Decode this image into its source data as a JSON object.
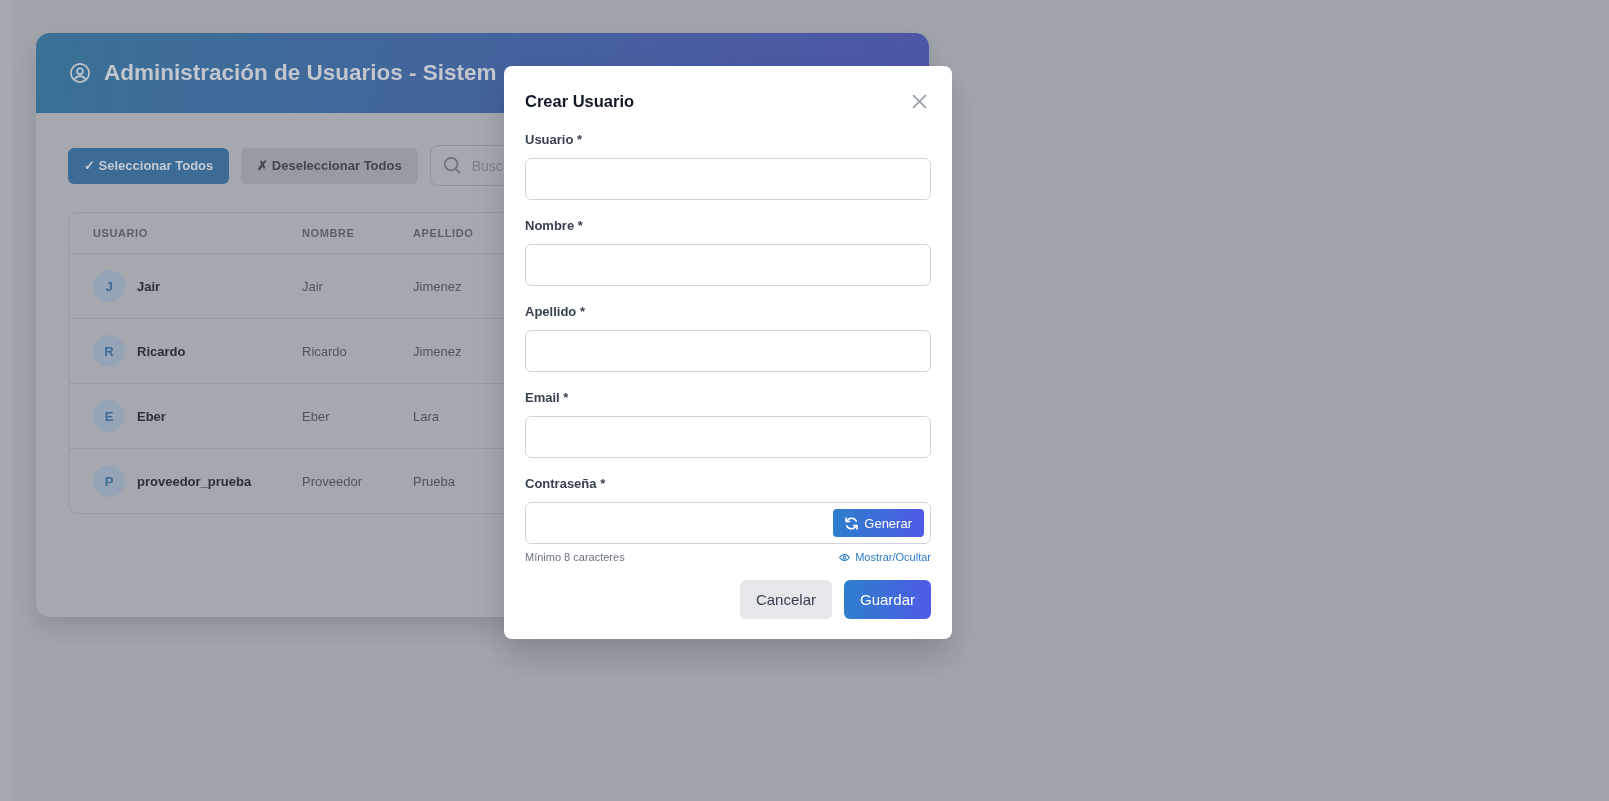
{
  "card": {
    "title": "Administración de Usuarios - Sistem",
    "actions": [
      {
        "kind": "primary",
        "label": "✓ Seleccionar Todos"
      },
      {
        "kind": "secondary",
        "label": "✗ Deseleccionar Todos"
      }
    ],
    "search": {
      "placeholder": "Busc"
    }
  },
  "table": {
    "columns": [
      "USUARIO",
      "NOMBRE",
      "APELLIDO"
    ],
    "rows": [
      {
        "initial": "J",
        "usuario": "Jair",
        "nombre": "Jair",
        "apellido": "Jimenez"
      },
      {
        "initial": "R",
        "usuario": "Ricardo",
        "nombre": "Ricardo",
        "apellido": "Jimenez"
      },
      {
        "initial": "E",
        "usuario": "Eber",
        "nombre": "Eber",
        "apellido": "Lara"
      },
      {
        "initial": "P",
        "usuario": "proveedor_prueba",
        "nombre": "Proveedor",
        "apellido": "Prueba"
      }
    ]
  },
  "modal": {
    "title": "Crear Usuario",
    "fields": [
      {
        "kind": "text",
        "label": "Usuario *"
      },
      {
        "kind": "text",
        "label": "Nombre *"
      },
      {
        "kind": "text",
        "label": "Apellido *"
      },
      {
        "kind": "text",
        "label": "Email *"
      },
      {
        "kind": "password",
        "label": "Contraseña *",
        "action": "Generar",
        "hint": "Mínimo 8 caracteres",
        "toggle": "Mostrar/Ocultar"
      }
    ],
    "buttons": [
      {
        "kind": "secondary",
        "label": "Cancelar"
      },
      {
        "kind": "primary",
        "label": "Guardar"
      }
    ]
  }
}
